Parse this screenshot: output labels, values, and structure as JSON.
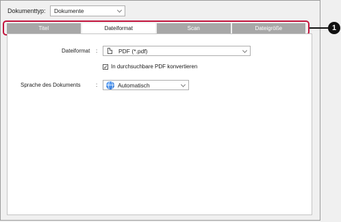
{
  "header": {
    "doctype_label": "Dokumenttyp:",
    "doctype_value": "Dokumente"
  },
  "tabs": [
    {
      "label": "Titel",
      "active": false
    },
    {
      "label": "Dateiformat",
      "active": true
    },
    {
      "label": "Scan",
      "active": false
    },
    {
      "label": "Dateigröße",
      "active": false
    }
  ],
  "panel": {
    "format_label": "Dateiformat",
    "format_colon": ":",
    "format_value": "PDF (*.pdf)",
    "format_icon": "document-icon",
    "searchable_checked": true,
    "searchable_label": "In durchsuchbare PDF konvertieren",
    "language_label": "Sprache des Dokuments",
    "language_colon": ":",
    "language_value": "Automatisch",
    "language_icon": "globe-icon"
  },
  "callout": {
    "number": "1",
    "color": "#c2143c"
  },
  "colors": {
    "tab_inactive": "#a7a7a7",
    "tab_active": "#ffffff",
    "highlight": "#c2143c"
  }
}
